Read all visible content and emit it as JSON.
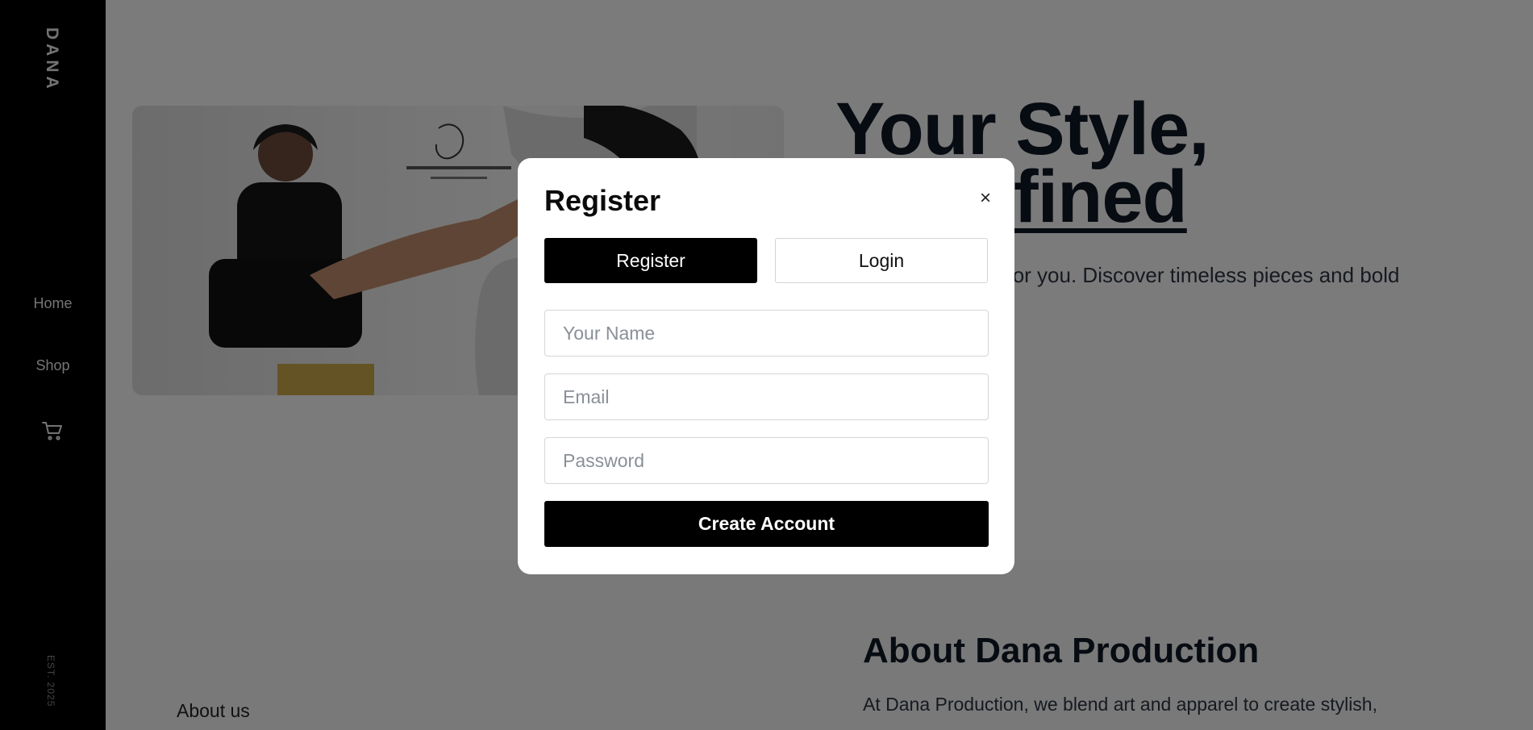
{
  "sidebar": {
    "brand": "DANA",
    "nav": [
      {
        "label": "Home"
      },
      {
        "label": "Shop"
      }
    ],
    "cart_icon": "cart-icon",
    "est": "EST. 2025"
  },
  "hero": {
    "title_line1": "Your Style,",
    "title_line2": "Redefined",
    "subtitle": "Fashion designed for you. Discover timeless pieces and bold looks."
  },
  "about": {
    "title": "About Dana Production",
    "text": "At Dana Production, we blend art and apparel to create stylish,",
    "image_alt": "About us"
  },
  "modal": {
    "title": "Register",
    "close_symbol": "×",
    "tabs": [
      {
        "label": "Register",
        "active": true
      },
      {
        "label": "Login",
        "active": false
      }
    ],
    "fields": {
      "name_placeholder": "Your Name",
      "email_placeholder": "Email",
      "password_placeholder": "Password"
    },
    "submit_label": "Create Account"
  },
  "colors": {
    "sidebar_bg": "#000000",
    "overlay": "rgba(0,0,0,0.5)",
    "primary_button": "#000000",
    "heading": "#0f1724"
  }
}
